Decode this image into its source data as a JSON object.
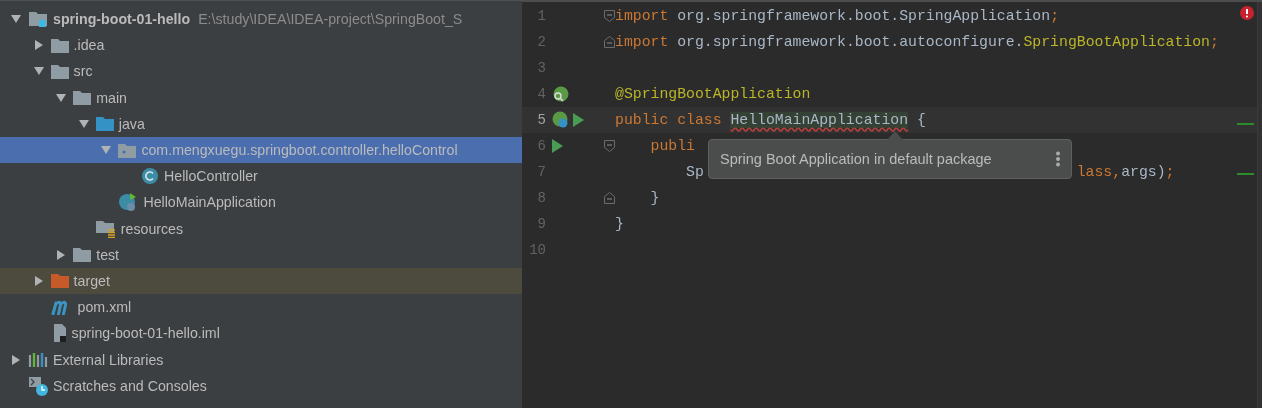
{
  "project_tree": {
    "items": [
      {
        "kind": "project",
        "label": "spring-boot-01-hello",
        "path": "E:\\study\\IDEA\\IDEA-project\\SpringBoot_S",
        "expanded": true,
        "selected": false,
        "excluded": false,
        "children": [
          {
            "kind": "folder",
            "label": ".idea",
            "expanded": false,
            "selected": false,
            "excluded": false
          },
          {
            "kind": "folder",
            "label": "src",
            "expanded": true,
            "selected": false,
            "excluded": false,
            "children": [
              {
                "kind": "folder",
                "label": "main",
                "expanded": true,
                "selected": false,
                "excluded": false,
                "children": [
                  {
                    "kind": "source-folder",
                    "label": "java",
                    "expanded": true,
                    "selected": false,
                    "excluded": false,
                    "children": [
                      {
                        "kind": "package",
                        "label": "com.mengxuegu.springboot.controller.helloControl",
                        "expanded": true,
                        "selected": true,
                        "excluded": false,
                        "children": [
                          {
                            "kind": "class",
                            "label": "HelloController",
                            "selected": false,
                            "excluded": false
                          }
                        ]
                      },
                      {
                        "kind": "spring-class",
                        "label": "HelloMainApplication",
                        "selected": false,
                        "excluded": false
                      }
                    ]
                  },
                  {
                    "kind": "resources",
                    "label": "resources",
                    "selected": false,
                    "excluded": false
                  }
                ]
              },
              {
                "kind": "folder",
                "label": "test",
                "expanded": false,
                "selected": false,
                "excluded": false
              }
            ]
          },
          {
            "kind": "excluded-folder",
            "label": "target",
            "expanded": false,
            "selected": false,
            "excluded": true
          },
          {
            "kind": "maven",
            "label": "pom.xml",
            "selected": false,
            "excluded": false
          },
          {
            "kind": "iml",
            "label": "spring-boot-01-hello.iml",
            "selected": false,
            "excluded": false
          }
        ]
      },
      {
        "kind": "libraries",
        "label": "External Libraries",
        "expanded": false,
        "selected": false,
        "excluded": false
      },
      {
        "kind": "scratches",
        "label": "Scratches and Consoles",
        "selected": false,
        "excluded": false
      }
    ]
  },
  "editor": {
    "lines": [
      {
        "number": "1",
        "current": false,
        "fold_start": true,
        "fold_end": false,
        "tokens": [
          {
            "kind": "keyword",
            "text": "import "
          },
          {
            "kind": "plain",
            "text": "org.springframework.boot.SpringApplication"
          },
          {
            "kind": "keyword",
            "text": ";"
          }
        ]
      },
      {
        "number": "2",
        "current": false,
        "fold_start": false,
        "fold_end": true,
        "tokens": [
          {
            "kind": "keyword",
            "text": "import "
          },
          {
            "kind": "plain",
            "text": "org.springframework.boot.autoconfigure."
          },
          {
            "kind": "annotation",
            "text": "SpringBootApplication"
          },
          {
            "kind": "keyword",
            "text": ";"
          }
        ]
      },
      {
        "number": "3",
        "current": false,
        "fold_start": false,
        "fold_end": false
      },
      {
        "number": "4",
        "current": false,
        "fold_start": false,
        "fold_end": false,
        "markers": [
          {
            "kind": "spring-search"
          }
        ],
        "tokens": [
          {
            "kind": "annotation",
            "text": "@SpringBootApplication"
          }
        ]
      },
      {
        "number": "5",
        "current": true,
        "fold_start": false,
        "fold_end": false,
        "markers": [
          {
            "kind": "spring-bean"
          },
          {
            "kind": "run"
          }
        ],
        "tokens": [
          {
            "kind": "keyword",
            "text": "public class "
          },
          {
            "kind": "warning",
            "text": "HelloMainApplication"
          },
          {
            "kind": "plain",
            "text": " {"
          }
        ]
      },
      {
        "number": "6",
        "current": false,
        "fold_start": true,
        "fold_end": false,
        "markers": [
          {
            "kind": "run"
          }
        ],
        "tokens": [
          {
            "kind": "keyword",
            "text": "    publi"
          }
        ]
      },
      {
        "number": "7",
        "current": false,
        "fold_start": false,
        "fold_end": false,
        "tokens": [
          {
            "kind": "plain",
            "text": "        Sp"
          }
        ],
        "tail": [
          {
            "kind": "keyword",
            "text": "lass,"
          },
          {
            "kind": "plain",
            "text": "args)"
          },
          {
            "kind": "keyword",
            "text": ";"
          }
        ]
      },
      {
        "number": "8",
        "current": false,
        "fold_start": false,
        "fold_end": true,
        "tokens": [
          {
            "kind": "plain",
            "text": "    }"
          }
        ]
      },
      {
        "number": "9",
        "current": false,
        "fold_start": false,
        "fold_end": false,
        "tokens": [
          {
            "kind": "plain",
            "text": "}"
          }
        ]
      },
      {
        "number": "10",
        "current": false,
        "fold_start": false,
        "fold_end": false
      }
    ],
    "tooltip": {
      "text": "Spring Boot Application in default package"
    }
  }
}
